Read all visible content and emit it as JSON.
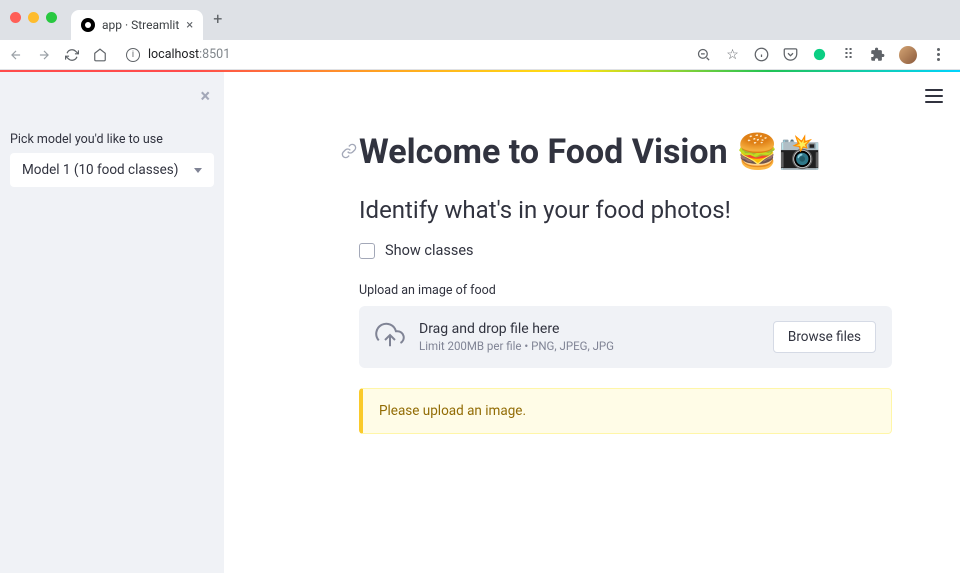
{
  "browser": {
    "tab_title": "app · Streamlit",
    "url_host": "localhost",
    "url_port": ":8501"
  },
  "sidebar": {
    "model_label": "Pick model you'd like to use",
    "model_selected": "Model 1 (10 food classes)"
  },
  "main": {
    "title": "Welcome to Food Vision 🍔📸",
    "subtitle": "Identify what's in your food photos!",
    "show_classes_label": "Show classes",
    "upload_label": "Upload an image of food",
    "upload_box": {
      "title": "Drag and drop file here",
      "hint": "Limit 200MB per file • PNG, JPEG, JPG",
      "browse_button": "Browse files"
    },
    "warning": "Please upload an image."
  }
}
